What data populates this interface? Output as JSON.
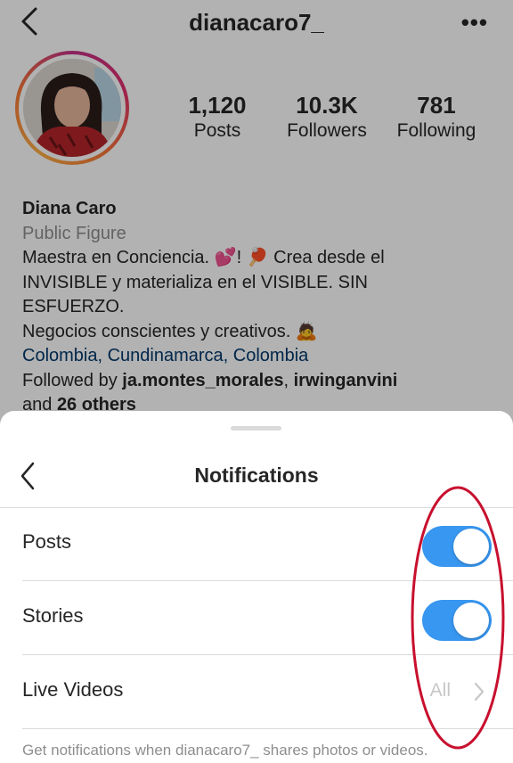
{
  "header": {
    "username": "dianacaro7_"
  },
  "stats": [
    {
      "value": "1,120",
      "label": "Posts"
    },
    {
      "value": "10.3K",
      "label": "Followers"
    },
    {
      "value": "781",
      "label": "Following"
    }
  ],
  "bio": {
    "name": "Diana Caro",
    "category": "Public Figure",
    "line1": "Maestra en Conciencia. 💕! 🏓 Crea desde el",
    "line2": "INVISIBLE y materializa en el VISIBLE. SIN",
    "line3": "ESFUERZO.",
    "line4": "Negocios conscientes y creativos. 🙇",
    "location": "Colombia, Cundinamarca, Colombia",
    "followed_prefix": "Followed by ",
    "followed_user1": "ja.montes_morales",
    "followed_sep": ", ",
    "followed_user2": "irwinganvini",
    "others_prefix": "and ",
    "others_count": "26 others"
  },
  "sheet": {
    "title": "Notifications",
    "rows": [
      {
        "label": "Posts",
        "enabled": true
      },
      {
        "label": "Stories",
        "enabled": true
      },
      {
        "label": "Live Videos",
        "value": "All"
      }
    ],
    "footer": "Get notifications when dianacaro7_ shares photos or videos."
  },
  "colors": {
    "toggle_on": "#3897f0",
    "annotation": "#c8102e",
    "location_link": "#00376b"
  },
  "icons": [
    "back-chevron-icon",
    "more-dots-icon",
    "chevron-right-icon"
  ]
}
